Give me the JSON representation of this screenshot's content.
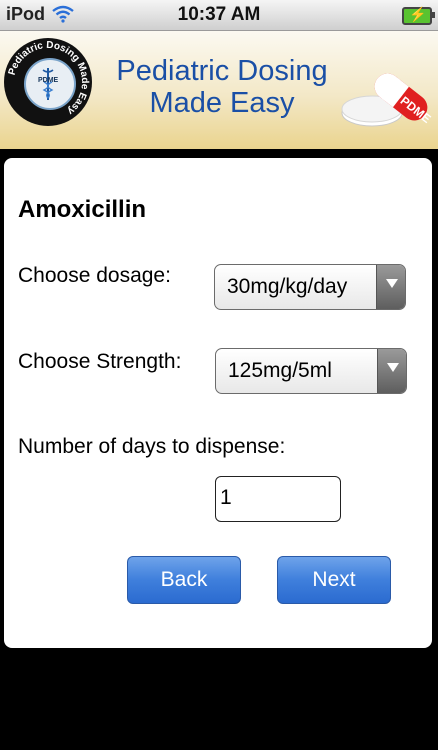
{
  "status_bar": {
    "carrier": "iPod",
    "time": "10:37 AM"
  },
  "banner": {
    "title_line1": "Pediatric Dosing",
    "title_line2": "Made Easy",
    "seal_text": "Pediatric Dosing Made Easy",
    "seal_abbrev": "PDME",
    "pill_text": "PDME"
  },
  "form": {
    "drug_name": "Amoxicillin",
    "dosage_label": "Choose dosage:",
    "dosage_value": "30mg/kg/day",
    "strength_label": "Choose Strength:",
    "strength_value": "125mg/5ml",
    "days_label": "Number of days to dispense:",
    "days_value": "1"
  },
  "buttons": {
    "back": "Back",
    "next": "Next"
  },
  "colors": {
    "accent": "#3f7fdc",
    "title_blue": "#1a4fa6",
    "banner_gold": "#ead48e"
  }
}
